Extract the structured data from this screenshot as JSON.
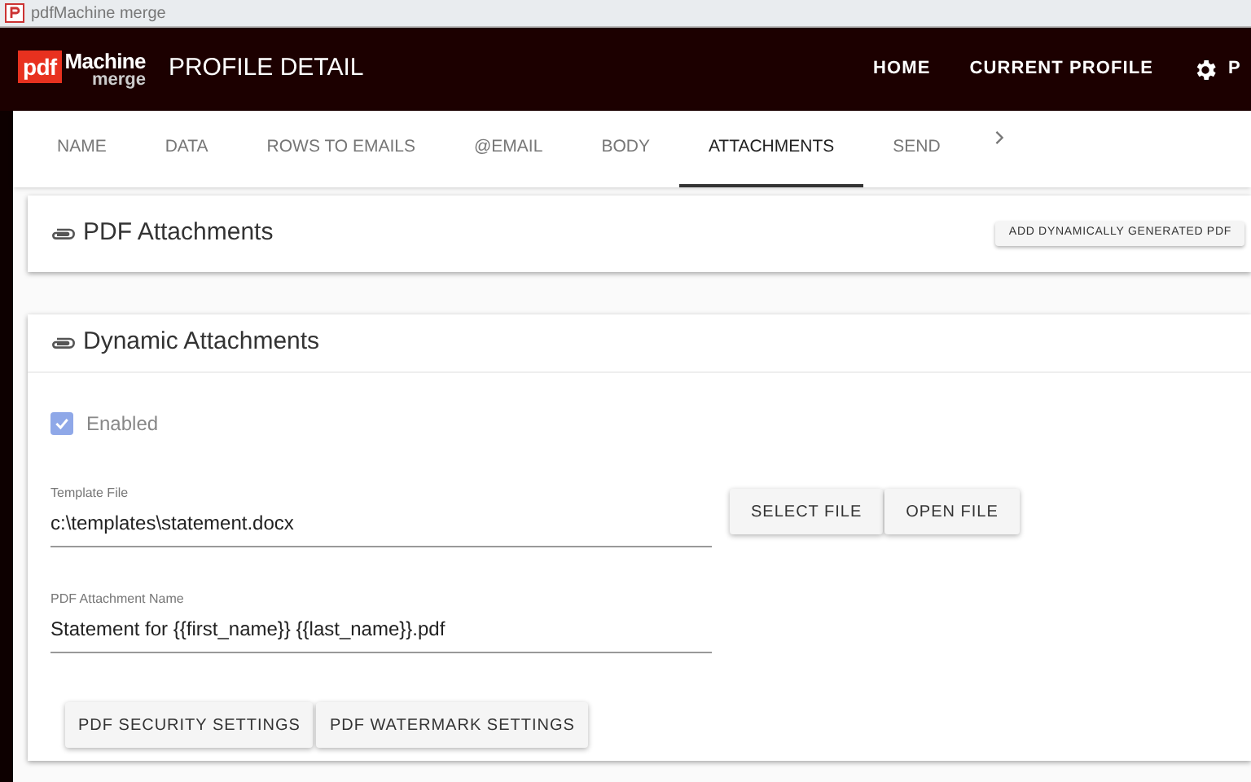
{
  "window": {
    "title": "pdfMachine merge"
  },
  "app_bar": {
    "logo": {
      "pdf": "pdf",
      "machine": "Machine",
      "merge": "merge"
    },
    "title": "PROFILE DETAIL",
    "links": [
      {
        "label": "HOME",
        "kind": "text"
      },
      {
        "label": "CURRENT PROFILE",
        "kind": "text"
      },
      {
        "label": "P",
        "kind": "settings"
      }
    ]
  },
  "tabs": [
    {
      "label": "NAME",
      "selected": false
    },
    {
      "label": "DATA",
      "selected": false
    },
    {
      "label": "ROWS TO EMAILS",
      "selected": false
    },
    {
      "label": "@EMAIL",
      "selected": false
    },
    {
      "label": "BODY",
      "selected": false
    },
    {
      "label": "ATTACHMENTS",
      "selected": true
    },
    {
      "label": "SEND",
      "selected": false
    }
  ],
  "pdf_attachments": {
    "title": "PDF Attachments",
    "button": "ADD DYNAMICALLY GENERATED PDF"
  },
  "dynamic_attachments": {
    "title": "Dynamic Attachments",
    "enabled": {
      "label": "Enabled",
      "checked": true
    },
    "template_file": {
      "label": "Template File",
      "value": "c:\\templates\\statement.docx"
    },
    "file_buttons": [
      "SELECT FILE",
      "OPEN FILE"
    ],
    "attachment_name": {
      "label": "PDF Attachment Name",
      "value": "Statement for {{first_name}} {{last_name}}.pdf"
    },
    "settings_buttons": [
      "PDF SECURITY SETTINGS",
      "PDF WATERMARK SETTINGS"
    ]
  }
}
